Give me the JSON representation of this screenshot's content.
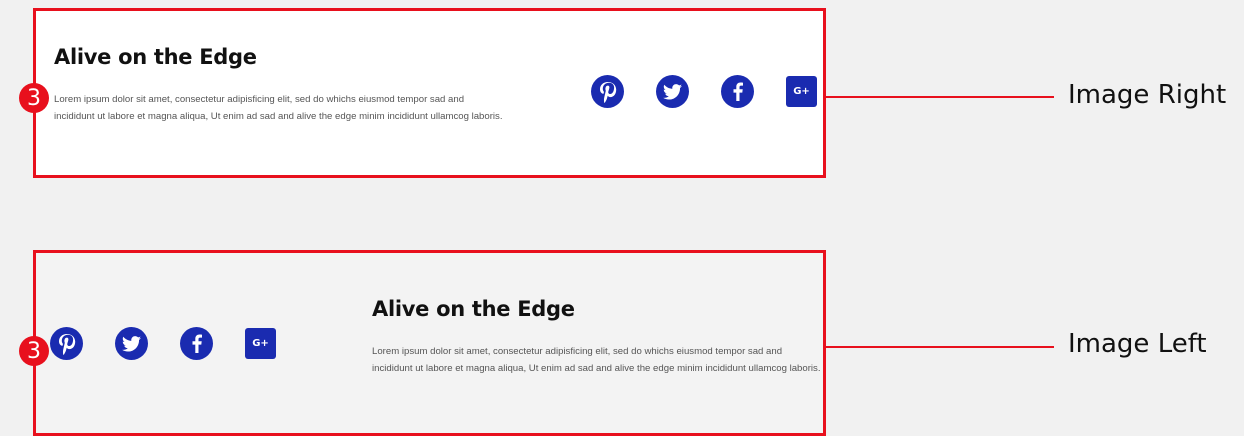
{
  "examples": [
    {
      "title": "Alive on the Edge",
      "body": "Lorem ipsum dolor sit amet, consectetur adipisficing elit, sed do whichs eiusmod tempor sad and incididunt ut labore et magna aliqua, Ut enim ad sad and alive the edge minim incididunt ullamcog laboris.",
      "badge": "3",
      "label": "Image Right"
    },
    {
      "title": "Alive on the Edge",
      "body": "Lorem ipsum dolor sit amet, consectetur adipisficing elit, sed do whichs eiusmod tempor sad and incididunt ut labore et magna aliqua, Ut enim ad sad and alive the edge minim incididunt ullamcog laboris.",
      "badge": "3",
      "label": "Image Left"
    }
  ],
  "social": {
    "icons": [
      "pinterest-icon",
      "twitter-icon",
      "facebook-icon",
      "google-plus-icon"
    ],
    "google_plus_text": "G+"
  },
  "colors": {
    "annotation_red": "#e8101d",
    "icon_blue": "#1a2bb0"
  }
}
